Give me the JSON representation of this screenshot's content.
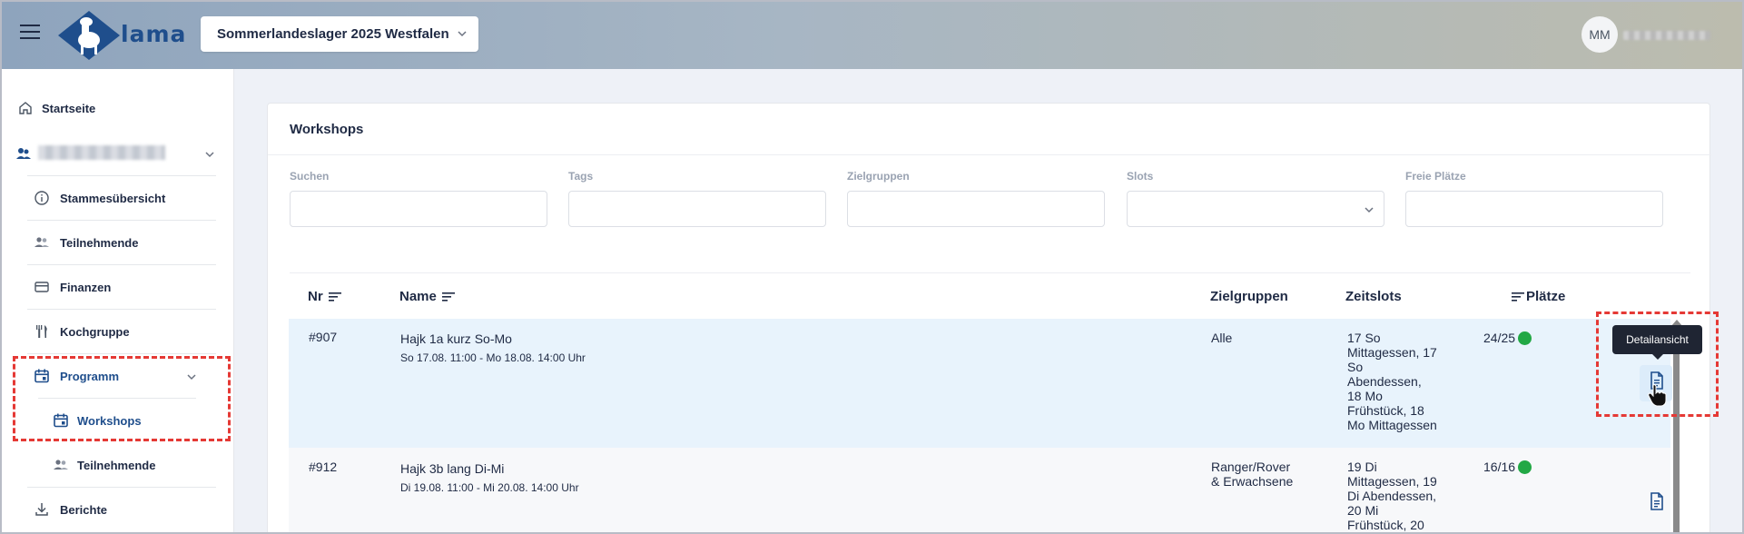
{
  "header": {
    "logo_text": "lama",
    "camp_selector": "Sommerlandeslager 2025 Westfalen",
    "avatar_initials": "MM"
  },
  "sidebar": {
    "home": "Startseite",
    "stammes_uebersicht": "Stammesübersicht",
    "teilnehmende": "Teilnehmende",
    "finanzen": "Finanzen",
    "kochgruppe": "Kochgruppe",
    "programm": "Programm",
    "workshops": "Workshops",
    "programm_teilnehmende": "Teilnehmende",
    "berichte": "Berichte"
  },
  "main": {
    "title": "Workshops",
    "filters": {
      "search": "Suchen",
      "tags": "Tags",
      "zielgruppen": "Zielgruppen",
      "slots": "Slots",
      "freie_plaetze": "Freie Plätze"
    },
    "table": {
      "headers": {
        "nr": "Nr",
        "name": "Name",
        "zielgruppen": "Zielgruppen",
        "zeitslots": "Zeitslots",
        "plaetze": "Plätze"
      },
      "rows": [
        {
          "nr": "#907",
          "name": "Hajk 1a kurz So-Mo",
          "dates": "So 17.08. 11:00 - Mo 18.08. 14:00 Uhr",
          "zielgruppen": "Alle",
          "zeitslots": [
            "17 So",
            "Mittagessen, 17",
            "So",
            "Abendessen,",
            "18 Mo",
            "Frühstück, 18",
            "Mo Mittagessen"
          ],
          "plaetze": "24/25"
        },
        {
          "nr": "#912",
          "name": "Hajk 3b lang Di-Mi",
          "dates": "Di 19.08. 11:00 - Mi 20.08. 14:00 Uhr",
          "zielgruppen": "Ranger/Rover & Erwachsene",
          "zeitslots": [
            "19 Di",
            "Mittagessen, 19",
            "Di Abendessen,",
            "20 Mi",
            "Frühstück, 20"
          ],
          "plaetze": "16/16"
        }
      ]
    },
    "tooltip": "Detailansicht"
  },
  "colors": {
    "accent": "#1f4e8c",
    "status_green": "#22a845",
    "highlight_row": "#e8f3fc",
    "annotation_red": "#e53935"
  }
}
